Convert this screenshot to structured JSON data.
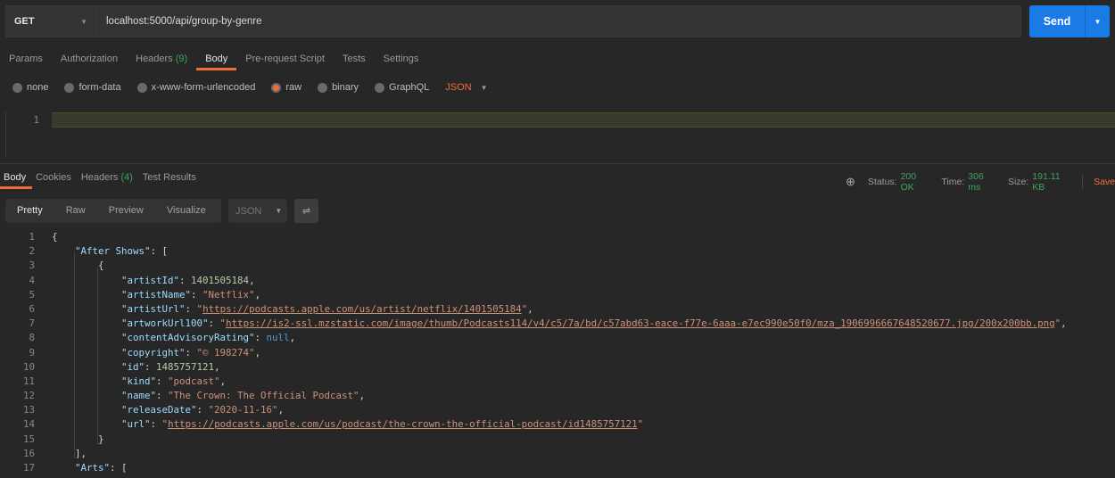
{
  "request": {
    "method": "GET",
    "url": "localhost:5000/api/group-by-genre",
    "send": "Send"
  },
  "request_tabs": [
    {
      "label": "Params"
    },
    {
      "label": "Authorization"
    },
    {
      "label": "Headers",
      "count": "(9)"
    },
    {
      "label": "Body",
      "active": true
    },
    {
      "label": "Pre-request Script"
    },
    {
      "label": "Tests"
    },
    {
      "label": "Settings"
    }
  ],
  "body_types": [
    {
      "label": "none"
    },
    {
      "label": "form-data"
    },
    {
      "label": "x-www-form-urlencoded"
    },
    {
      "label": "raw",
      "selected": true
    },
    {
      "label": "binary"
    },
    {
      "label": "GraphQL"
    }
  ],
  "body_format": "JSON",
  "editor": {
    "line": "1"
  },
  "response_tabs": [
    {
      "label": "Body",
      "active": true
    },
    {
      "label": "Cookies"
    },
    {
      "label": "Headers",
      "count": "(4)"
    },
    {
      "label": "Test Results"
    }
  ],
  "status": {
    "status_label": "Status:",
    "status": "200 OK",
    "time_label": "Time:",
    "time": "306 ms",
    "size_label": "Size:",
    "size": "191.11 KB",
    "save": "Save"
  },
  "view_modes": [
    {
      "label": "Pretty",
      "active": true
    },
    {
      "label": "Raw"
    },
    {
      "label": "Preview"
    },
    {
      "label": "Visualize"
    }
  ],
  "response_format": "JSON",
  "colors": {
    "accent": "#f26b3a",
    "send": "#1a7be6",
    "success": "#3fa35a",
    "key": "#9cdcfe",
    "string": "#ce9178",
    "number": "#b5cea8",
    "null": "#569cd6"
  },
  "code_lines": [
    [
      [
        "p",
        "{"
      ]
    ],
    [
      [
        "p",
        "    "
      ],
      [
        "k",
        "\"After Shows\""
      ],
      [
        "p",
        ": ["
      ]
    ],
    [
      [
        "p",
        "        {"
      ]
    ],
    [
      [
        "p",
        "            "
      ],
      [
        "k",
        "\"artistId\""
      ],
      [
        "p",
        ": "
      ],
      [
        "num",
        "1401505184"
      ],
      [
        "p",
        ","
      ]
    ],
    [
      [
        "p",
        "            "
      ],
      [
        "k",
        "\"artistName\""
      ],
      [
        "p",
        ": "
      ],
      [
        "s",
        "\"Netflix\""
      ],
      [
        "p",
        ","
      ]
    ],
    [
      [
        "p",
        "            "
      ],
      [
        "k",
        "\"artistUrl\""
      ],
      [
        "p",
        ": "
      ],
      [
        "s",
        "\""
      ],
      [
        "u",
        "https://podcasts.apple.com/us/artist/netflix/1401505184"
      ],
      [
        "s",
        "\""
      ],
      [
        "p",
        ","
      ]
    ],
    [
      [
        "p",
        "            "
      ],
      [
        "k",
        "\"artworkUrl100\""
      ],
      [
        "p",
        ": "
      ],
      [
        "s",
        "\""
      ],
      [
        "u",
        "https://is2-ssl.mzstatic.com/image/thumb/Podcasts114/v4/c5/7a/bd/c57abd63-eace-f77e-6aaa-e7ec990e50f0/mza_1906996667648520677.jpg/200x200bb.png"
      ],
      [
        "s",
        "\""
      ],
      [
        "p",
        ","
      ]
    ],
    [
      [
        "p",
        "            "
      ],
      [
        "k",
        "\"contentAdvisoryRating\""
      ],
      [
        "p",
        ": "
      ],
      [
        "nl",
        "null"
      ],
      [
        "p",
        ","
      ]
    ],
    [
      [
        "p",
        "            "
      ],
      [
        "k",
        "\"copyright\""
      ],
      [
        "p",
        ": "
      ],
      [
        "s",
        "\"© 198274\""
      ],
      [
        "p",
        ","
      ]
    ],
    [
      [
        "p",
        "            "
      ],
      [
        "k",
        "\"id\""
      ],
      [
        "p",
        ": "
      ],
      [
        "num",
        "1485757121"
      ],
      [
        "p",
        ","
      ]
    ],
    [
      [
        "p",
        "            "
      ],
      [
        "k",
        "\"kind\""
      ],
      [
        "p",
        ": "
      ],
      [
        "s",
        "\"podcast\""
      ],
      [
        "p",
        ","
      ]
    ],
    [
      [
        "p",
        "            "
      ],
      [
        "k",
        "\"name\""
      ],
      [
        "p",
        ": "
      ],
      [
        "s",
        "\"The Crown: The Official Podcast\""
      ],
      [
        "p",
        ","
      ]
    ],
    [
      [
        "p",
        "            "
      ],
      [
        "k",
        "\"releaseDate\""
      ],
      [
        "p",
        ": "
      ],
      [
        "s",
        "\"2020-11-16\""
      ],
      [
        "p",
        ","
      ]
    ],
    [
      [
        "p",
        "            "
      ],
      [
        "k",
        "\"url\""
      ],
      [
        "p",
        ": "
      ],
      [
        "s",
        "\""
      ],
      [
        "u",
        "https://podcasts.apple.com/us/podcast/the-crown-the-official-podcast/id1485757121"
      ],
      [
        "s",
        "\""
      ]
    ],
    [
      [
        "p",
        "        }"
      ]
    ],
    [
      [
        "p",
        "    ],"
      ]
    ],
    [
      [
        "p",
        "    "
      ],
      [
        "k",
        "\"Arts\""
      ],
      [
        "p",
        ": ["
      ]
    ]
  ]
}
